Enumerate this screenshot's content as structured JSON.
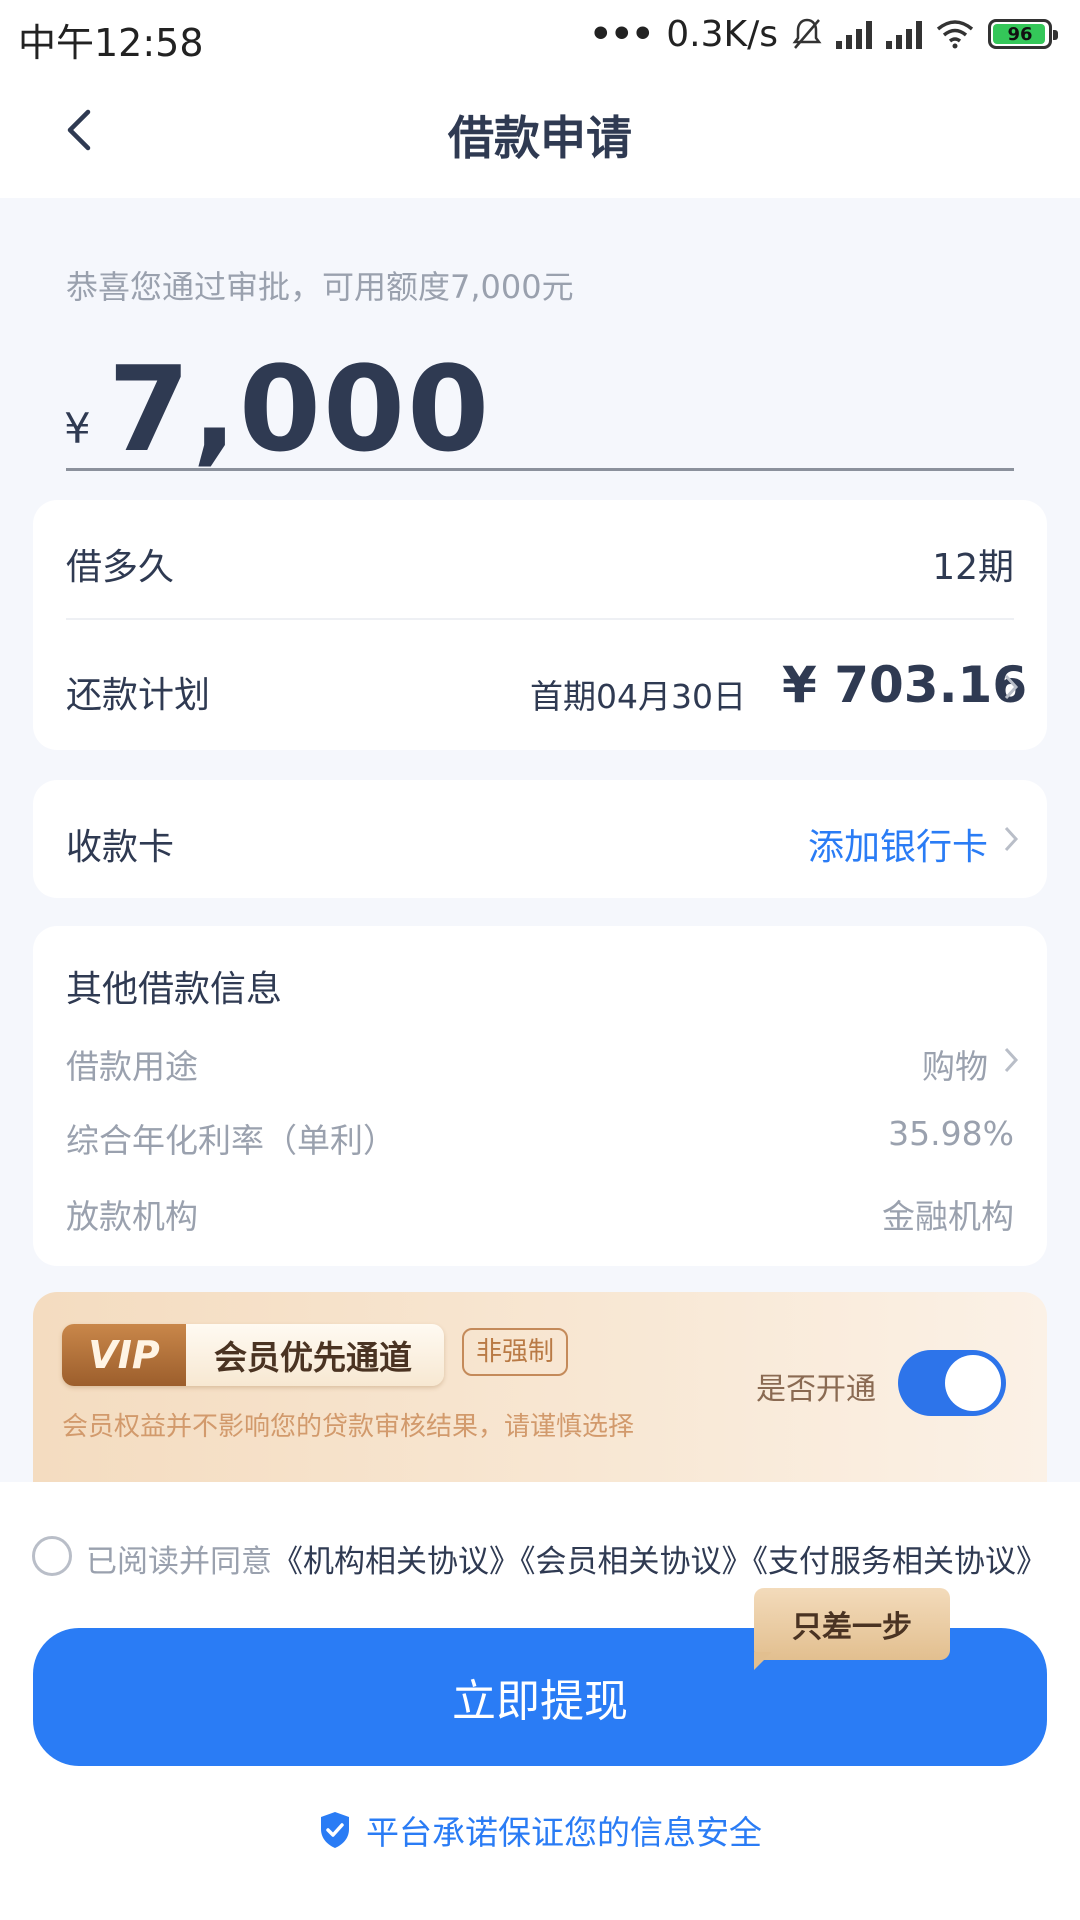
{
  "status_bar": {
    "time": "中午12:58",
    "network_speed": "0.3K/s",
    "battery": "96"
  },
  "header": {
    "title": "借款申请",
    "back_icon": "chevron-left-icon"
  },
  "approval": {
    "message": "恭喜您通过审批，可用额度7,000元",
    "currency_symbol": "¥",
    "amount": "7,000"
  },
  "loan_terms": {
    "duration_label": "借多久",
    "duration_value": "12期",
    "plan_label": "还款计划",
    "plan_first": "首期04月30日",
    "plan_amount": "¥ 703.16"
  },
  "receive_card": {
    "label": "收款卡",
    "action": "添加银行卡"
  },
  "other_info": {
    "title": "其他借款信息",
    "purpose_label": "借款用途",
    "purpose_value": "购物",
    "rate_label": "综合年化利率（单利）",
    "rate_value": "35.98%",
    "lender_label": "放款机构",
    "lender_value": "金融机构"
  },
  "vip": {
    "badge_left": "VIP",
    "badge_right": "会员优先通道",
    "tag": "非强制",
    "note": "会员权益并不影响您的贷款审核结果，请谨慎选择",
    "toggle_label": "是否开通",
    "toggle_on": true
  },
  "agreement": {
    "prefix": "已阅读并同意",
    "links": "《机构相关协议》《会员相关协议》《支付服务相关协议》"
  },
  "submit": {
    "label": "立即提现",
    "tip": "只差一步"
  },
  "footer": {
    "secure_text": "平台承诺保证您的信息安全"
  },
  "colors": {
    "primary": "#2a7cf5",
    "text_dark": "#2f3a52",
    "text_muted": "#9aa1ae",
    "background": "#f5f7fc"
  }
}
